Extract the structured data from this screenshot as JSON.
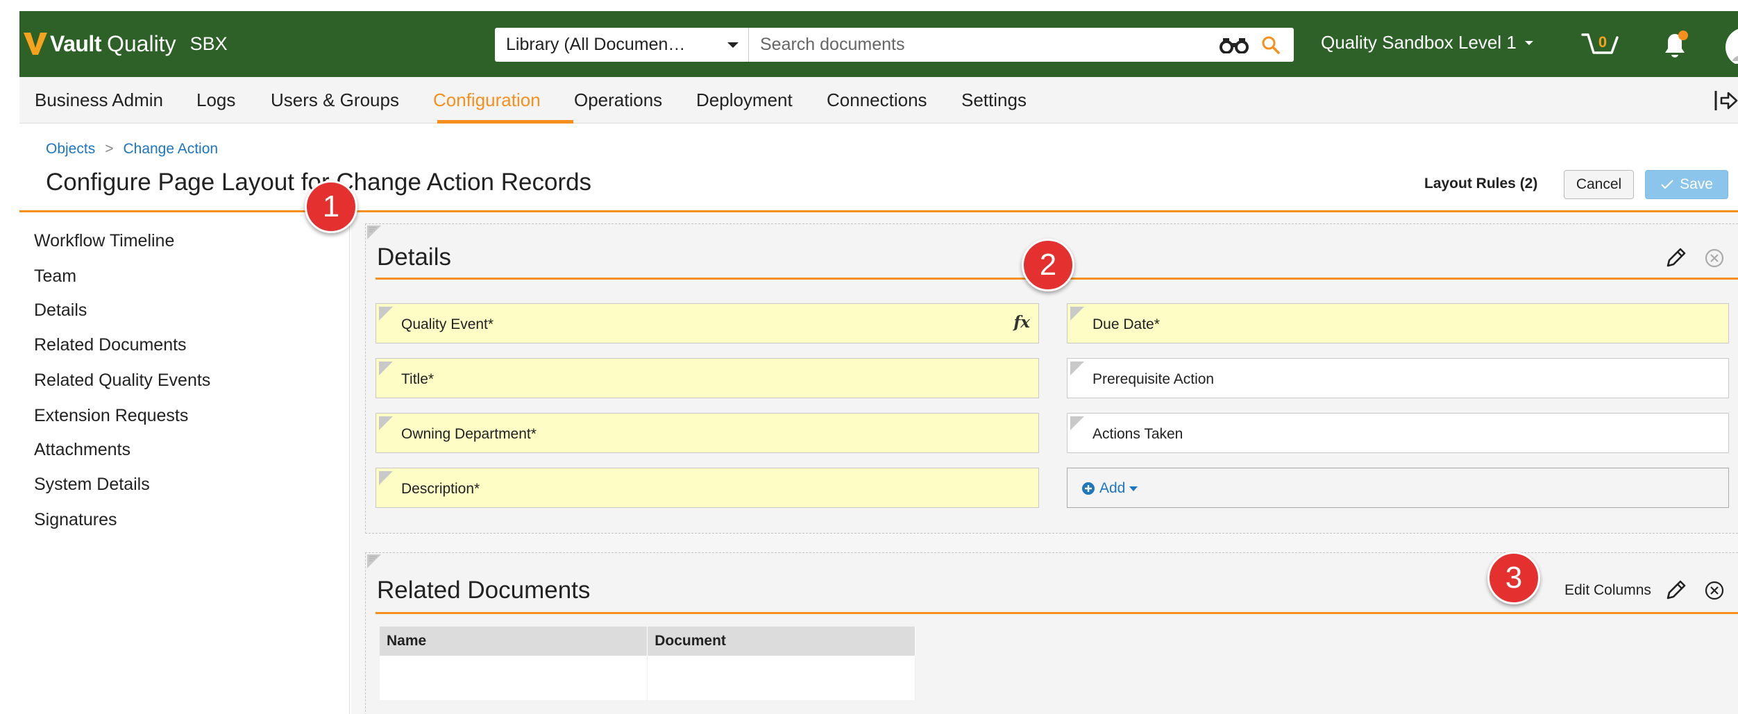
{
  "header": {
    "logo_brand": "Vault",
    "logo_product": "Quality",
    "env_badge": "SBX",
    "library_select": "Library (All Documen…",
    "search_placeholder": "Search documents",
    "vault_name": "Quality Sandbox Level 1",
    "cart_count": "0"
  },
  "nav": {
    "items": [
      "Business Admin",
      "Logs",
      "Users & Groups",
      "Configuration",
      "Operations",
      "Deployment",
      "Connections",
      "Settings"
    ],
    "active": "Configuration"
  },
  "breadcrumb": [
    "Objects",
    "Change Action"
  ],
  "breadcrumb_sep": ">",
  "page_title": "Configure Page Layout for Change Action Records",
  "actions": {
    "layout_rules": "Layout Rules (2)",
    "cancel": "Cancel",
    "save": "Save"
  },
  "sections": [
    "Workflow Timeline",
    "Team",
    "Details",
    "Related Documents",
    "Related Quality Events",
    "Extension Requests",
    "Attachments",
    "System Details",
    "Signatures"
  ],
  "details_panel": {
    "title": "Details",
    "left_fields": [
      {
        "label": "Quality Event*",
        "required": true,
        "formula": "fx"
      },
      {
        "label": "Title*",
        "required": true
      },
      {
        "label": "Owning Department*",
        "required": true
      },
      {
        "label": "Description*",
        "required": true
      }
    ],
    "right_fields": [
      {
        "label": "Due Date*",
        "required": true
      },
      {
        "label": "Prerequisite Action",
        "required": false
      },
      {
        "label": "Actions Taken",
        "required": false
      }
    ],
    "add_label": "Add"
  },
  "related_panel": {
    "title": "Related Documents",
    "edit_columns": "Edit Columns",
    "columns": [
      "Name",
      "Document"
    ]
  },
  "badges": [
    "1",
    "2",
    "3"
  ],
  "colors": {
    "header_green": "#2d6128",
    "accent_orange": "#f5901e",
    "link_blue": "#1e76be",
    "required_field_yellow": "#fdfdc5",
    "save_blue": "#8cc5ec",
    "badge_red": "#e53030"
  }
}
